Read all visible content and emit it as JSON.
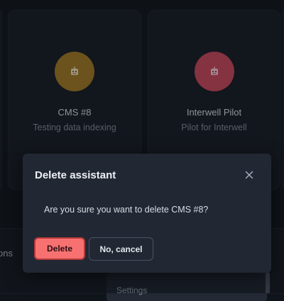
{
  "assistants": [
    {
      "name": "CMS #8",
      "description": "Testing data indexing",
      "avatar_color": "#a07a2a",
      "avatar_icon": "robot-icon"
    },
    {
      "name": "Interwell Pilot",
      "description": "Pilot for Interwell",
      "avatar_color": "#c44a61",
      "avatar_icon": "robot-icon"
    }
  ],
  "background": {
    "partial_label": "ons",
    "menu_item": "Settings"
  },
  "dialog": {
    "title": "Delete assistant",
    "message": "Are you sure you want to delete CMS #8?",
    "confirm_label": "Delete",
    "cancel_label": "No, cancel",
    "close_icon": "close-icon"
  },
  "colors": {
    "danger": "#f87171",
    "dialog_bg": "#222833",
    "page_bg": "#161b23"
  }
}
